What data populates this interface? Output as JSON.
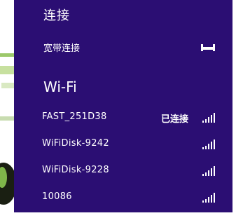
{
  "connections": {
    "title": "连接",
    "broadband": {
      "label": "宽带连接",
      "icon": "ethernet-icon"
    }
  },
  "wifi": {
    "heading": "Wi-Fi",
    "networks": [
      {
        "name": "FAST_251D38",
        "status": "已连接",
        "icon": "wifi-signal-icon"
      },
      {
        "name": "WiFiDisk-9242",
        "status": "",
        "icon": "wifi-signal-icon"
      },
      {
        "name": "WiFiDisk-9228",
        "status": "",
        "icon": "wifi-signal-icon"
      },
      {
        "name": "10086",
        "status": "",
        "icon": "wifi-signal-icon"
      }
    ]
  },
  "colors": {
    "panel_background": "#2b0e73",
    "text": "#ffffff"
  }
}
